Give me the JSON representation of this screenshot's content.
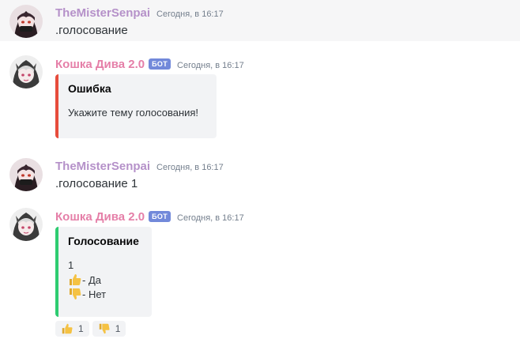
{
  "messages": [
    {
      "username": "TheMisterSenpai",
      "timestamp": "Сегодня, в 16:17",
      "text": ".голосование"
    },
    {
      "username": "Кошка Дива 2.0",
      "bot_tag": "БОТ",
      "timestamp": "Сегодня, в 16:17",
      "embed": {
        "color": "#e74c3c",
        "title": "Ошибка",
        "description": "Укажите тему голосования!"
      }
    },
    {
      "username": "TheMisterSenpai",
      "timestamp": "Сегодня, в 16:17",
      "text": ".голосование 1"
    },
    {
      "username": "Кошка Дива 2.0",
      "bot_tag": "БОТ",
      "timestamp": "Сегодня, в 16:17",
      "embed": {
        "color": "#2ecc71",
        "title": "Голосование",
        "description": "1",
        "options": [
          {
            "icon": "thumbs-up-icon",
            "label": "- Да"
          },
          {
            "icon": "thumbs-down-icon",
            "label": "- Нет"
          }
        ]
      },
      "reactions": [
        {
          "icon": "thumbs-up-icon",
          "count": "1"
        },
        {
          "icon": "thumbs-down-icon",
          "count": "1"
        }
      ]
    }
  ],
  "colors": {
    "senpai_name": "#b591c9",
    "bot_name": "#e57fa8",
    "bot_tag": "#7289da",
    "error_embed": "#e74c3c",
    "vote_embed": "#2ecc71"
  }
}
